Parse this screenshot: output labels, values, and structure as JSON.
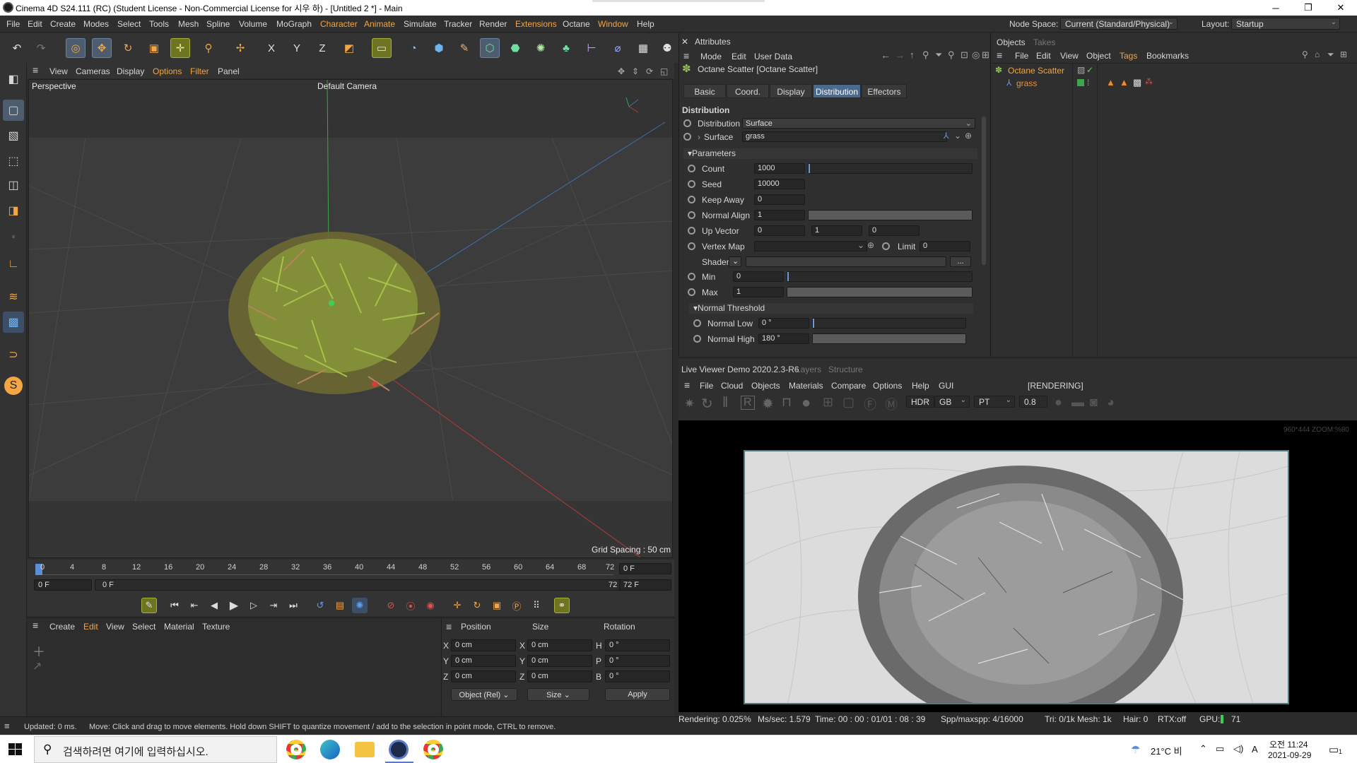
{
  "window": {
    "title": "Cinema 4D S24.111 (RC) (Student License - Non-Commercial License for 시우 하) - [Untitled 2 *] - Main",
    "controls": [
      "─",
      "❐",
      "✕"
    ]
  },
  "menubar": {
    "items": [
      "File",
      "Edit",
      "Create",
      "Modes",
      "Select",
      "Tools",
      "Mesh",
      "Spline",
      "Volume",
      "MoGraph",
      "Character",
      "Animate",
      "Simulate",
      "Tracker",
      "Render",
      "Extensions",
      "Octane",
      "Window",
      "Help"
    ],
    "node_space_label": "Node Space:",
    "node_space_value": "Current (Standard/Physical)",
    "layout_label": "Layout:",
    "layout_value": "Startup"
  },
  "viewport": {
    "menu": [
      "View",
      "Cameras",
      "Display",
      "Options",
      "Filter",
      "Panel"
    ],
    "view_name": "Perspective",
    "camera": "Default Camera",
    "grid_spacing": "Grid Spacing : 50 cm"
  },
  "timeline": {
    "ticks": [
      "0",
      "4",
      "8",
      "12",
      "16",
      "20",
      "24",
      "28",
      "32",
      "36",
      "40",
      "44",
      "48",
      "52",
      "56",
      "60",
      "64",
      "68",
      "72"
    ],
    "current_frame": "0 F",
    "start_frame": "0 F",
    "range_start": "0 F",
    "range_end": "72 F",
    "end_frame": "72 F"
  },
  "material_panel": {
    "menu": [
      "Create",
      "Edit",
      "View",
      "Select",
      "Material",
      "Texture"
    ]
  },
  "coords": {
    "headers": [
      "Position",
      "Size",
      "Rotation"
    ],
    "rows": [
      {
        "axis": "X",
        "pos": "0 cm",
        "saxis": "X",
        "size": "0 cm",
        "raxis": "H",
        "rot": "0 °"
      },
      {
        "axis": "Y",
        "pos": "0 cm",
        "saxis": "Y",
        "size": "0 cm",
        "raxis": "P",
        "rot": "0 °"
      },
      {
        "axis": "Z",
        "pos": "0 cm",
        "saxis": "Z",
        "size": "0 cm",
        "raxis": "B",
        "rot": "0 °"
      }
    ],
    "mode": "Object (Rel)",
    "size_mode": "Size",
    "apply": "Apply"
  },
  "status": {
    "updated": "Updated: 0 ms.",
    "hint": "Move: Click and drag to move elements. Hold down SHIFT to quantize movement / add to the selection in point mode, CTRL to remove."
  },
  "attributes": {
    "panel_title": "Attributes",
    "menu": [
      "Mode",
      "Edit",
      "User Data"
    ],
    "object_title": "Octane Scatter [Octane Scatter]",
    "tabs": [
      "Basic",
      "Coord.",
      "Display",
      "Distribution",
      "Effectors"
    ],
    "section": "Distribution",
    "distribution_label": "Distribution",
    "distribution_value": "Surface",
    "surface_label": "Surface",
    "surface_value": "grass",
    "parameters_group": "Parameters",
    "params": [
      {
        "label": "Count",
        "value": "1000",
        "fill": 0.0
      },
      {
        "label": "Seed",
        "value": "10000"
      },
      {
        "label": "Keep Away",
        "value": "0"
      },
      {
        "label": "Normal Align",
        "value": "1",
        "fill": 1.0
      }
    ],
    "up_vector_label": "Up Vector",
    "up_vector": [
      "0",
      "1",
      "0"
    ],
    "vertex_map_label": "Vertex Map",
    "limit_label": "Limit",
    "limit_value": "0",
    "shader_label": "Shader",
    "shader_btn": "...",
    "min_label": "Min",
    "min_value": "0",
    "min_fill": 0.0,
    "max_label": "Max",
    "max_value": "1",
    "max_fill": 1.0,
    "threshold_group": "Normal Threshold",
    "normal_low_label": "Normal Low",
    "normal_low_value": "0 °",
    "normal_low_fill": 0.0,
    "normal_high_label": "Normal High",
    "normal_high_value": "180 °",
    "normal_high_fill": 1.0
  },
  "objects": {
    "tabs": [
      "Objects",
      "Takes"
    ],
    "menu": [
      "File",
      "Edit",
      "View",
      "Object",
      "Tags",
      "Bookmarks"
    ],
    "items": [
      {
        "name": "Octane Scatter",
        "color": "#f3a641"
      },
      {
        "name": "grass",
        "color": "#e8923a"
      }
    ]
  },
  "live_viewer": {
    "title": "Live Viewer Demo 2020.2.3-R6",
    "tabs": [
      "Layers",
      "Structure"
    ],
    "menu": [
      "File",
      "Cloud",
      "Objects",
      "Materials",
      "Compare",
      "Options",
      "Help",
      "GUI"
    ],
    "state": "[RENDERING]",
    "hdr_mode": "HDR",
    "color_mode": "GB",
    "kernel": "PT",
    "exposure": "0.8",
    "resolution": "960*444 ZOOM:%80"
  },
  "render_status": {
    "rendering": "Rendering: 0.025%",
    "ms": "Ms/sec: 1.579",
    "time": "Time: 00 : 00 : 01/01 : 08 : 39",
    "spp": "Spp/maxspp: 4/16000",
    "tri": "Tri: 0/1k",
    "mesh": "Mesh: 1k",
    "hair": "Hair: 0",
    "rtx": "RTX:off",
    "gpu_label": "GPU:",
    "gpu_value": "71"
  },
  "taskbar": {
    "search_placeholder": "검색하려면 여기에 입력하십시오.",
    "weather": "21°C 비",
    "lang": "A",
    "time": "오전 11:24",
    "date": "2021-09-29",
    "notif": "1"
  },
  "colors": {
    "accent": "#f3a641",
    "selection_blue": "#4b6a8e",
    "render_border": "#507b80"
  }
}
